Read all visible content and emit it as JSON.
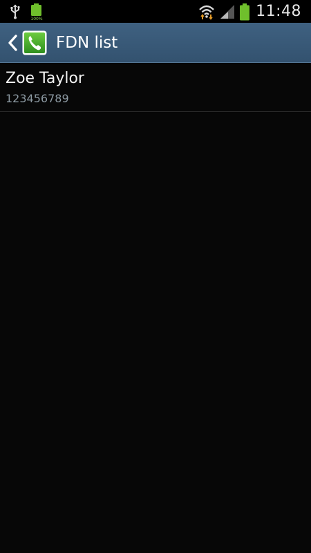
{
  "status_bar": {
    "time": "11:48",
    "icons": [
      "usb-icon",
      "battery-full-notification-icon",
      "wifi-icon",
      "signal-icon",
      "battery-icon"
    ],
    "battery_color": "#6fbf2c"
  },
  "action_bar": {
    "title": "FDN list",
    "background": "#3a5a78",
    "icon": "phone-app-icon"
  },
  "fdn_list": {
    "items": [
      {
        "name": "Zoe Taylor",
        "number": "123456789"
      }
    ]
  }
}
